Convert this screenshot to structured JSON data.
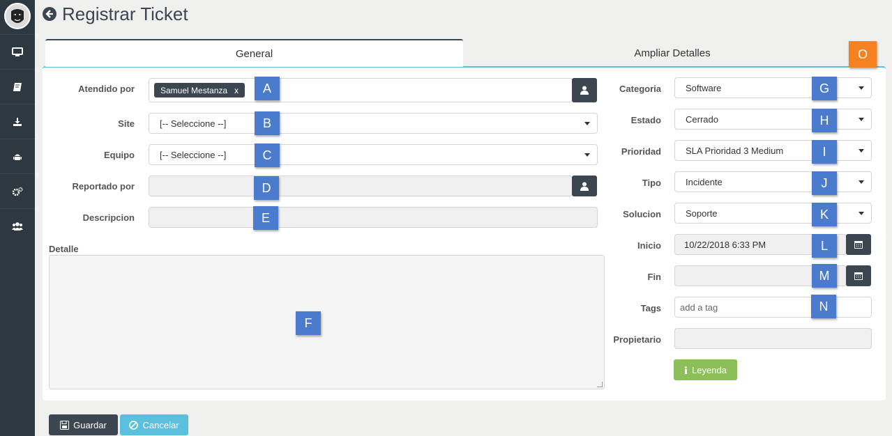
{
  "title": "Registrar Ticket",
  "tabs": {
    "general": "General",
    "ampliar": "Ampliar Detalles"
  },
  "left_form": {
    "atendido_label": "Atendido por",
    "atendido_chip": "Samuel Mestanza",
    "atendido_chip_remove": "x",
    "site_label": "Site",
    "site_value": "[-- Seleccione --]",
    "equipo_label": "Equipo",
    "equipo_value": "[-- Seleccione --]",
    "reportado_label": "Reportado por",
    "descripcion_label": "Descripcion",
    "detalle_label": "Detalle"
  },
  "right_form": {
    "categoria_label": "Categoria",
    "categoria_value": "Software",
    "estado_label": "Estado",
    "estado_value": "Cerrado",
    "prioridad_label": "Prioridad",
    "prioridad_value": "SLA Prioridad 3 Medium",
    "tipo_label": "Tipo",
    "tipo_value": "Incidente",
    "solucion_label": "Solucion",
    "solucion_value": "Soporte",
    "inicio_label": "Inicio",
    "inicio_value": "10/22/2018 6:33 PM",
    "fin_label": "Fin",
    "tags_label": "Tags",
    "tags_placeholder": "add a tag",
    "propietario_label": "Propietario",
    "leyenda_button": "Leyenda"
  },
  "markers": [
    "A",
    "B",
    "C",
    "D",
    "E",
    "F",
    "G",
    "H",
    "I",
    "J",
    "K",
    "L",
    "M",
    "N",
    "O"
  ],
  "actions": {
    "guardar": "Guardar",
    "cancelar": "Cancelar"
  },
  "colors": {
    "sidebar": "#2d3841",
    "dark_button": "#3b4651",
    "marker_blue": "#4b7bcc",
    "marker_orange": "#f58220",
    "leyenda_green": "#8cbe5a",
    "cancel_blue": "#5bc0de"
  },
  "icons": {
    "sidebar": [
      "monitor-icon",
      "book-icon",
      "download-icon",
      "android-icon",
      "cogs-icon",
      "users-icon"
    ],
    "user_picker": "user-icon",
    "calendar": "calendar-icon",
    "back": "back-arrow-icon"
  }
}
